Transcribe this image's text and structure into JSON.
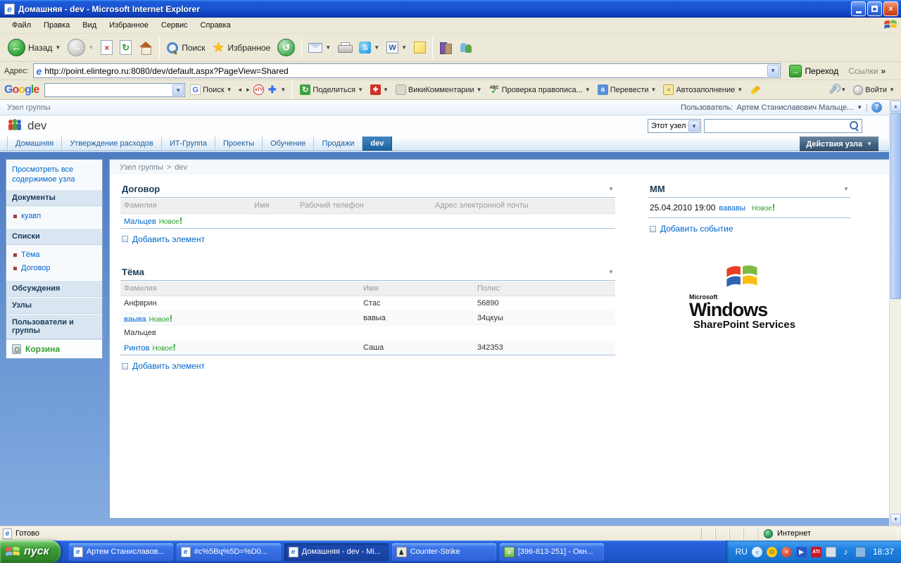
{
  "window": {
    "title": "Домашняя - dev - Microsoft Internet Explorer"
  },
  "menu": {
    "items": [
      "Файл",
      "Правка",
      "Вид",
      "Избранное",
      "Сервис",
      "Справка"
    ]
  },
  "toolbar": {
    "back_label": "Назад",
    "search_label": "Поиск",
    "favorites_label": "Избранное"
  },
  "address_bar": {
    "label": "Адрес:",
    "url": "http://point.elintegro.ru:8080/dev/default.aspx?PageView=Shared",
    "go_label": "Переход",
    "links_label": "Ссылки"
  },
  "google_bar": {
    "logo_letters": [
      "G",
      "o",
      "o",
      "g",
      "l",
      "e"
    ],
    "search_label": "Поиск",
    "etv_label": "eTV",
    "share_label": "Поделиться",
    "wiki_label": "ВикиКомментарии",
    "spell_icon_text": "ABC",
    "spell_label": "Проверка правописа...",
    "translate_icon_text": "а",
    "translate_label": "Перевести",
    "autofill_label": "Автозаполнение",
    "signin_label": "Войти"
  },
  "sharepoint": {
    "portal_label": "Узел группы",
    "user_label": "Пользователь:",
    "user_name": "Артем Станиславович Мальце...",
    "site_title": "dev",
    "search_scope": "Этот узел",
    "tabs": [
      "Домашняя",
      "Утверждение расходов",
      "ИТ-Группа",
      "Проекты",
      "Обучение",
      "Продажи",
      "dev"
    ],
    "site_actions_label": "Действия узла",
    "breadcrumb": {
      "root": "Узел группы",
      "sep": ">",
      "current": "dev"
    },
    "sidebar": {
      "view_all": "Просмотреть все содержимое узла",
      "sections": [
        {
          "header": "Документы",
          "items": [
            "куавп"
          ]
        },
        {
          "header": "Списки",
          "items": [
            "Тёма",
            "Договор"
          ]
        },
        {
          "header": "Обсуждения",
          "items": []
        },
        {
          "header": "Узлы",
          "items": []
        },
        {
          "header": "Пользователи и группы",
          "items": []
        }
      ],
      "recycle_label": "Корзина"
    },
    "new_badge": {
      "text": "Новое",
      "excl": "!"
    },
    "dogovor": {
      "title": "Договор",
      "columns": [
        "Фамилия",
        "Имя",
        "Рабочий телефон",
        "Адрес электронной почты"
      ],
      "rows": [
        {
          "surname": "Мальцев"
        }
      ],
      "add_label": "Добавить элемент"
    },
    "tema": {
      "title": "Тёма",
      "columns": [
        "Фамилия",
        "Имя",
        "Полис"
      ],
      "rows": [
        {
          "surname": "Анфврин",
          "name": "Стас",
          "polis": "56890"
        },
        {
          "surname": "ваыва",
          "name": "вавыа",
          "polis": "34цкуы"
        },
        {
          "surname": "Мальцев",
          "name": "",
          "polis": ""
        },
        {
          "surname": "Ринтов",
          "name": "Саша",
          "polis": "342353"
        }
      ],
      "add_label": "Добавить элемент"
    },
    "mm": {
      "title": "ММ",
      "event_datetime": "25.04.2010 19:00",
      "event_title": "вававы",
      "add_label": "Добавить событие"
    },
    "logo": {
      "microsoft": "Microsoft",
      "windows": "Windows",
      "line2": "SharePoint Services"
    }
  },
  "status_bar": {
    "ready": "Готово",
    "zone": "Интернет"
  },
  "taskbar": {
    "start_label": "пуск",
    "buttons": [
      {
        "label": "Артем Станиславов..."
      },
      {
        "label": "#c%5Bq%5D=%D0..."
      },
      {
        "label": "Домашняя - dev - Mi..."
      },
      {
        "label": "Counter-Strike"
      },
      {
        "label": "[396-813-251] - Окн..."
      }
    ],
    "lang": "RU",
    "time": "18:37"
  },
  "colors": {
    "link_blue": "#0066CC",
    "navy": "#1B3A57",
    "new_green": "#2F9E2F",
    "xp_blue": "#1E55C8",
    "start_green": "#3E9E38"
  }
}
